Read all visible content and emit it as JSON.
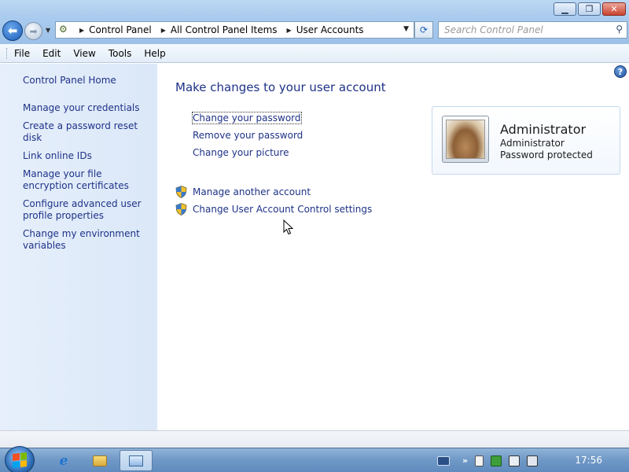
{
  "window": {
    "minimize_glyph": "▁",
    "maximize_glyph": "❐",
    "close_glyph": "✕"
  },
  "address_bar": {
    "crumbs": [
      "Control Panel",
      "All Control Panel Items",
      "User Accounts"
    ]
  },
  "search": {
    "placeholder": "Search Control Panel"
  },
  "menu": {
    "file": "File",
    "edit": "Edit",
    "view": "View",
    "tools": "Tools",
    "help": "Help"
  },
  "sidebar": {
    "home": "Control Panel Home",
    "items": [
      "Manage your credentials",
      "Create a password reset disk",
      "Link online IDs",
      "Manage your file encryption certificates",
      "Configure advanced user profile properties",
      "Change my environment variables"
    ]
  },
  "main": {
    "heading": "Make changes to your user account",
    "tasks": [
      "Change your password",
      "Remove your password",
      "Change your picture"
    ],
    "shield_tasks": [
      "Manage another account",
      "Change User Account Control settings"
    ]
  },
  "account": {
    "name": "Administrator",
    "type": "Administrator",
    "status": "Password protected"
  },
  "taskbar": {
    "clock": "17:56",
    "show_hidden": "»"
  },
  "colors": {
    "link": "#1e3287",
    "sidebar_bg": "#e6effb"
  }
}
